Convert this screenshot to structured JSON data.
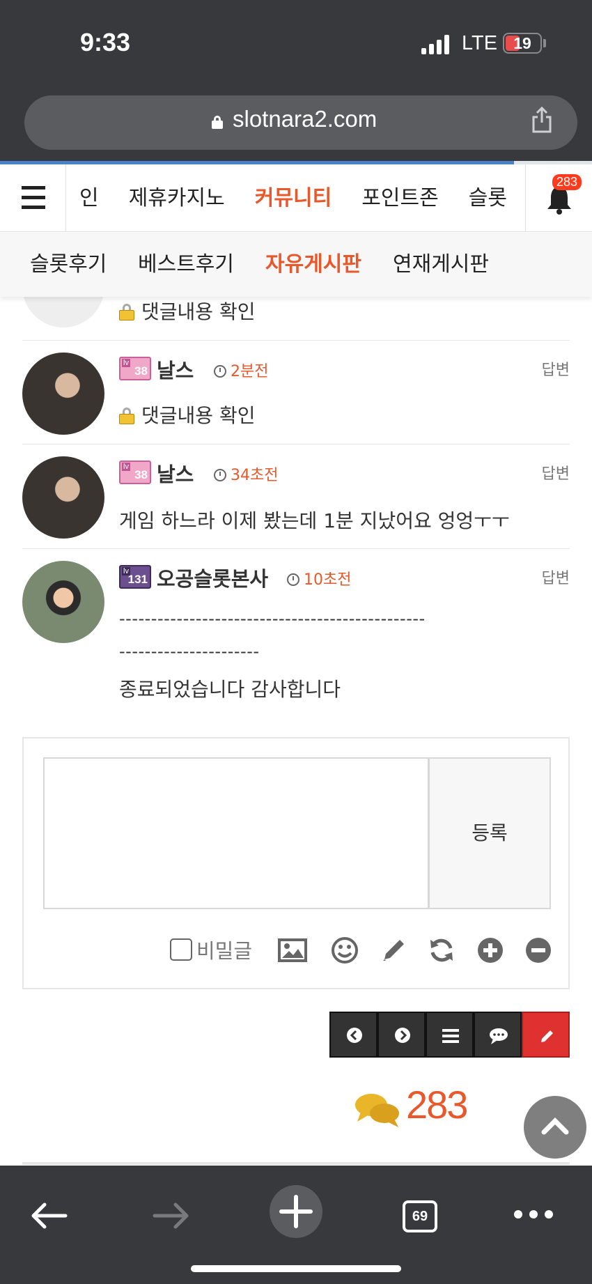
{
  "status_bar": {
    "time": "9:33",
    "network": "LTE",
    "battery": "19"
  },
  "browser": {
    "url": "slotnara2.com",
    "tab_count": "69"
  },
  "main_nav": {
    "items": [
      {
        "label": "인"
      },
      {
        "label": "제휴카지노"
      },
      {
        "label": "커뮤니티"
      },
      {
        "label": "포인트존"
      },
      {
        "label": "슬롯"
      }
    ],
    "active": "커뮤니티",
    "notification_count": "283"
  },
  "sub_nav": {
    "items": [
      {
        "label": "슬롯후기"
      },
      {
        "label": "베스트후기"
      },
      {
        "label": "자유게시판"
      },
      {
        "label": "연재게시판"
      }
    ],
    "active": "자유게시판"
  },
  "comments": [
    {
      "text": "댓글내용 확인",
      "locked": true
    },
    {
      "level": "38",
      "name": "날스",
      "time": "2분전",
      "reply": "답변",
      "text": "댓글내용 확인",
      "locked": true
    },
    {
      "level": "38",
      "name": "날스",
      "time": "34초전",
      "reply": "답변",
      "text": "게임 하느라 이제 봤는데 1분 지났어요 엉엉ㅜㅜ",
      "locked": false
    },
    {
      "level": "131",
      "name": "오공슬롯본사",
      "time": "10초전",
      "reply": "답변",
      "text_line1": "------------------------------------------------",
      "text_line2": "----------------------",
      "text_line3": "종료되었습니다 감사합니다",
      "locked": false
    }
  ],
  "lv_prefix": "lv",
  "editor": {
    "submit_label": "등록",
    "secret_label": "비밀글"
  },
  "comment_total": "283",
  "colors": {
    "accent": "#e8582a",
    "badge": "#ff3b1e",
    "action_red": "#e03131",
    "chrome": "#38393d"
  }
}
